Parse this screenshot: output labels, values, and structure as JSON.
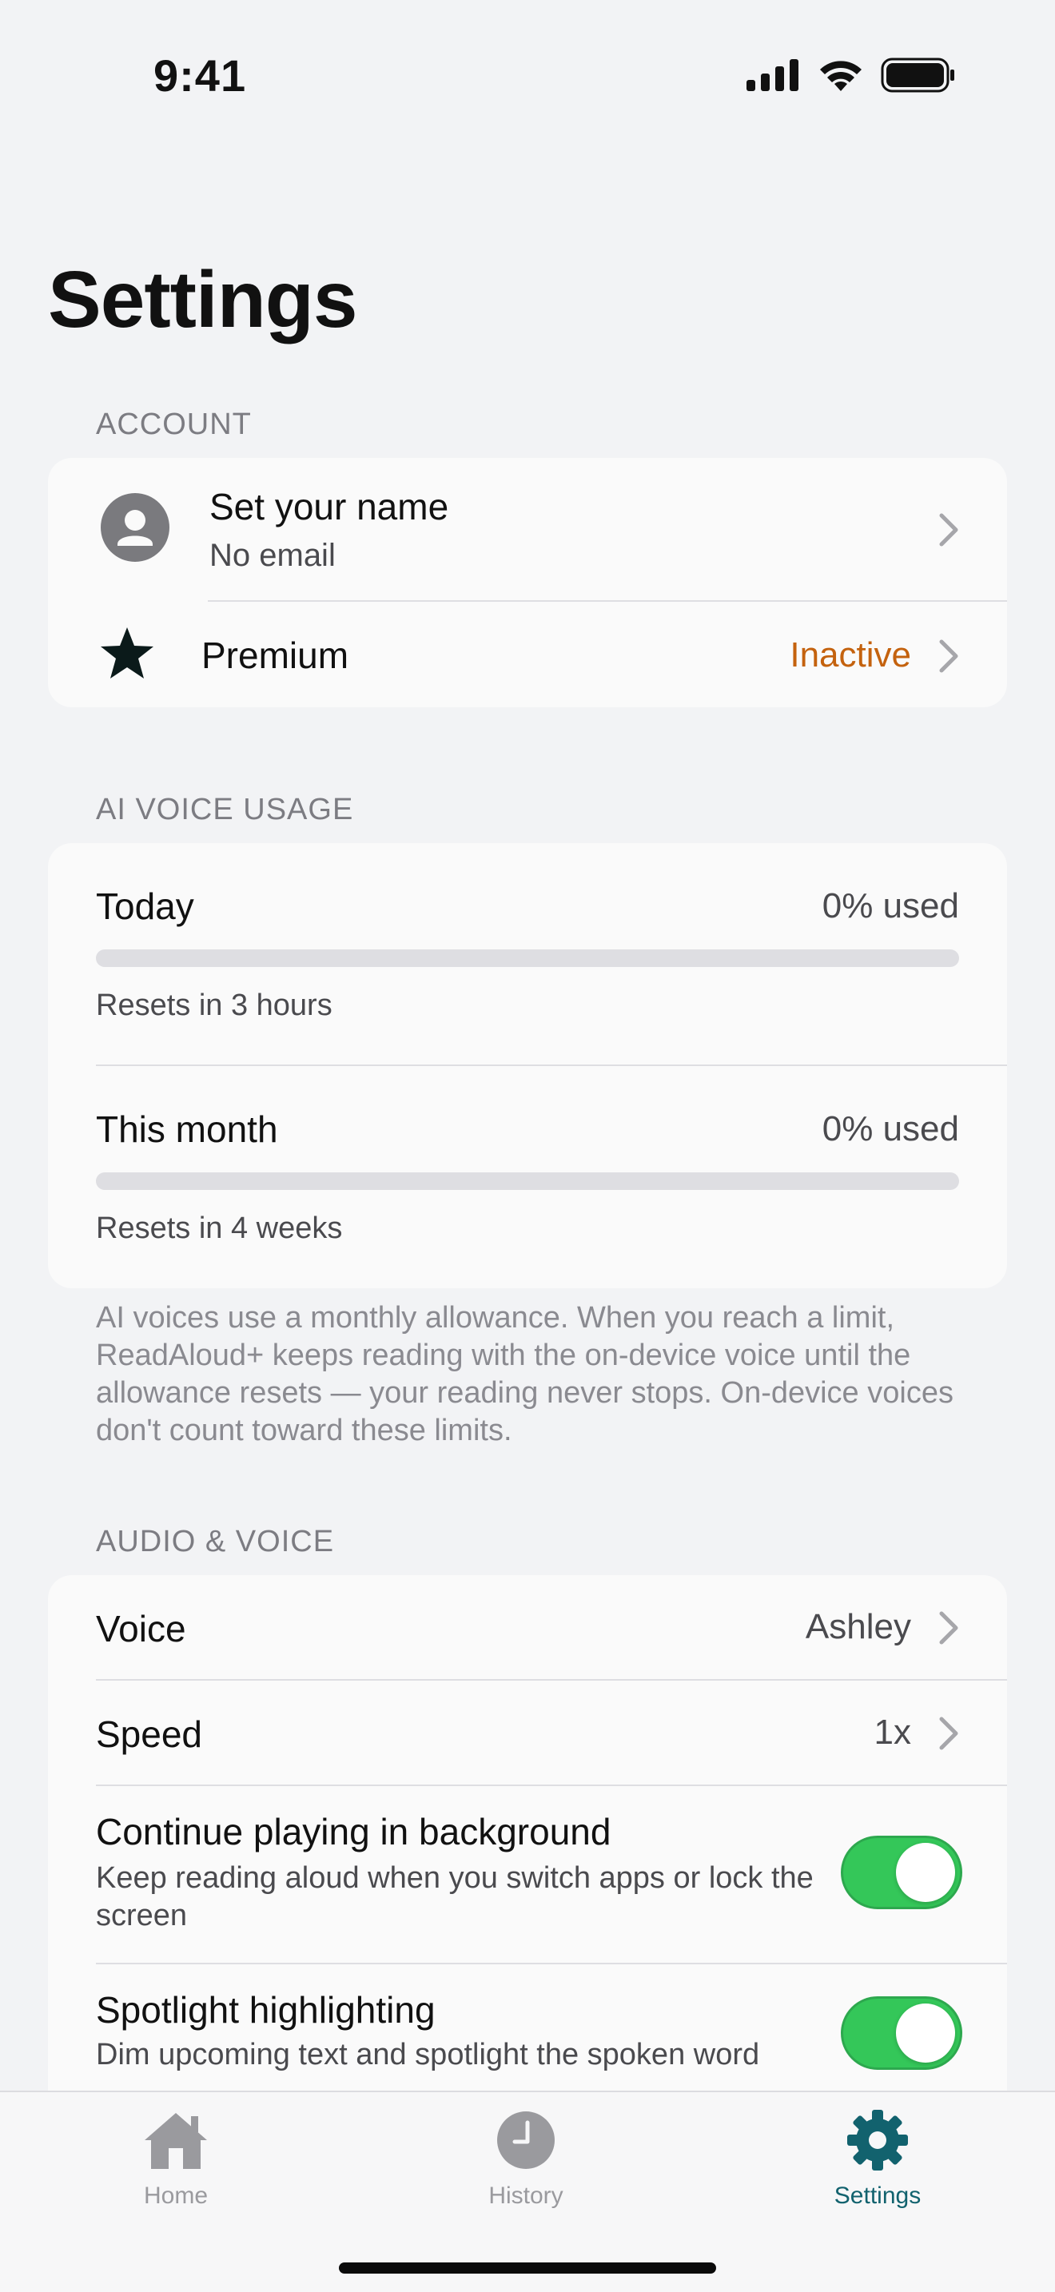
{
  "status_bar": {
    "time": "9:41"
  },
  "page": {
    "title": "Settings"
  },
  "account": {
    "header": "ACCOUNT",
    "profile": {
      "name": "Set your name",
      "email": "No email",
      "icon": "person-icon"
    },
    "premium": {
      "label": "Premium",
      "status": "Inactive",
      "icon": "star-icon",
      "status_color": "#C4620E"
    }
  },
  "usage": {
    "header": "AI VOICE USAGE",
    "today": {
      "label": "Today",
      "value": "0% used",
      "reset": "Resets in 3 hours",
      "progress": 0
    },
    "month": {
      "label": "This month",
      "value": "0% used",
      "reset": "Resets in 4 weeks",
      "progress": 0
    },
    "note": "AI voices use a monthly allowance. When you reach a limit, ReadAloud+ keeps reading with the on-device voice until the allowance resets — your reading never stops. On-device voices don't count toward these limits."
  },
  "audio": {
    "header": "AUDIO & VOICE",
    "voice": {
      "label": "Voice",
      "value": "Ashley"
    },
    "speed": {
      "label": "Speed",
      "value": "1x"
    },
    "background": {
      "label": "Continue playing in background",
      "desc": "Keep reading aloud when you switch apps or lock the screen",
      "on": true
    },
    "spotlight": {
      "label": "Spotlight highlighting",
      "desc": "Dim upcoming text and spotlight the spoken word",
      "on": true
    }
  },
  "tabs": [
    {
      "label": "Home",
      "icon": "house-icon",
      "active": false
    },
    {
      "label": "History",
      "icon": "clock-icon",
      "active": false
    },
    {
      "label": "Settings",
      "icon": "gear-icon",
      "active": true
    }
  ],
  "colors": {
    "accent": "#12626E",
    "toggle_on": "#34C759",
    "background": "#F2F3F5"
  }
}
